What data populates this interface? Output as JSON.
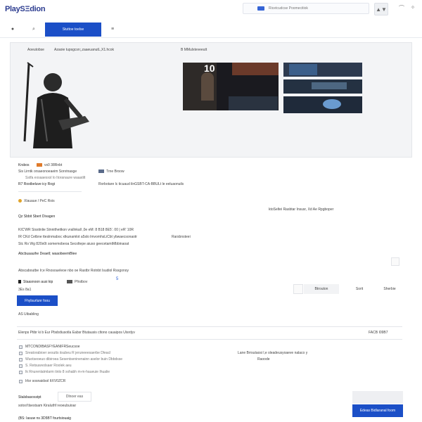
{
  "header": {
    "logo": "PlaySΞdion",
    "search_placeholder": "Ricetcudcse Poomecitiok",
    "arrow_label": "▲▼"
  },
  "toolbar": {
    "active_tab_label": "Stuttoe toelse"
  },
  "panel": {
    "caption_left": "Aoeutobse",
    "caption_left_title": "Azaoie tupsgcsn;,zaaeuanutL,X1.hcok",
    "caption_right": "B MMulxteveeutt",
    "shot_number": "10"
  },
  "info": {
    "row1_label": "Krsbos",
    "row1_value": "vs0 38Rnbt",
    "row2": "Sis Lirntk orsaeonoeaeim Sonrinasge",
    "row2_right": "Trne Broow",
    "row3": "Sstfa exsaaesxsl lo Itoranaure waaatilt",
    "row4_label": "R7 Rostbeluve icy Rogi",
    "row4_right": "Rorbotare lc ticuaud ilnGSBT-CA-BBULt le eeluaonuils",
    "rating_line": "Xlauaue / PeC Rois",
    "section_title": "Qz Sbbit Sbert Divagen",
    "section_right": "ktoSeltei Rasbtar Insusr, Xd Ae Rpgboper",
    "desc1": "KIC'WR Sisstinlie Stnnitheitkon vrallnkall ,0e eM: 8 B18 8E5'. 00 | eR' 10R",
    "desc2": "IR CKd Cetbne tteslnmaboc xtkunamlot a5slo lmvomhsLiCbt ybwaecsonaotr",
    "desc2_right": "Rarsbnsteei",
    "desc3": "Stc Ro Wg 820o0t somemobeoa Secoltepe aiuso geecetamtMbbinaoat",
    "title_line": "Abcbuaauihe Deaetl; waaobwemBlee",
    "summary": "Abscaboutbe Ir;e Rnosoueleoe nbo oe Rastbr Rotnbt Isudiol Rssgonoy",
    "platform_label": "Staasnoon ausi kip",
    "platform_right": "Pfrstbov",
    "platform_icon": "5",
    "sub_label": "3Es  8a1",
    "seg1": "Btrouton",
    "seg2": "Sorit",
    "seg3": "Sherbie",
    "primary_button": "Fhylsurlunr foou",
    "subheading": "AS Uibabling",
    "long_line": "Elenps Ptibr ki b Eur Pbsbdiusotla Eabsr Btutausis cltono cauaipos Uisrdyv",
    "long_right": "FACB I09B7",
    "list_header": "MTCONDIBASFYEANIFRSeucsoe",
    "list": [
      "Sreatorabioer sesutts iisubeu R jeruneeesaerbe Dleacl",
      "Wuotseoeuo dibiroea Sesentseninenainn aselor buin Dbbdsse",
      "S. Retsuwvolsaer Roolek aeu",
      "Ik Rnurenlatmlarm tinlo 8 xxhabh m-m-haueuie Ihualie"
    ],
    "list_right1": "Lane  Brrsutaosi l,e sleadeusyoaeve nalaco y",
    "list_right2": "Raoode",
    "footer_check": "Irlsr sosnaidsol  ItXV0ZCR",
    "bottom1": "Stalsbasosstpt",
    "bottom1_field": "Dlnoer eas",
    "bottom2": "sotoo'tlsestsam Kiraluthf  reoeubuioar",
    "bottom3": "(BS: Iasuw ns 3D5BT fourtsiouaig",
    "bottom_button": "Edeas Bidlaranal foom"
  }
}
